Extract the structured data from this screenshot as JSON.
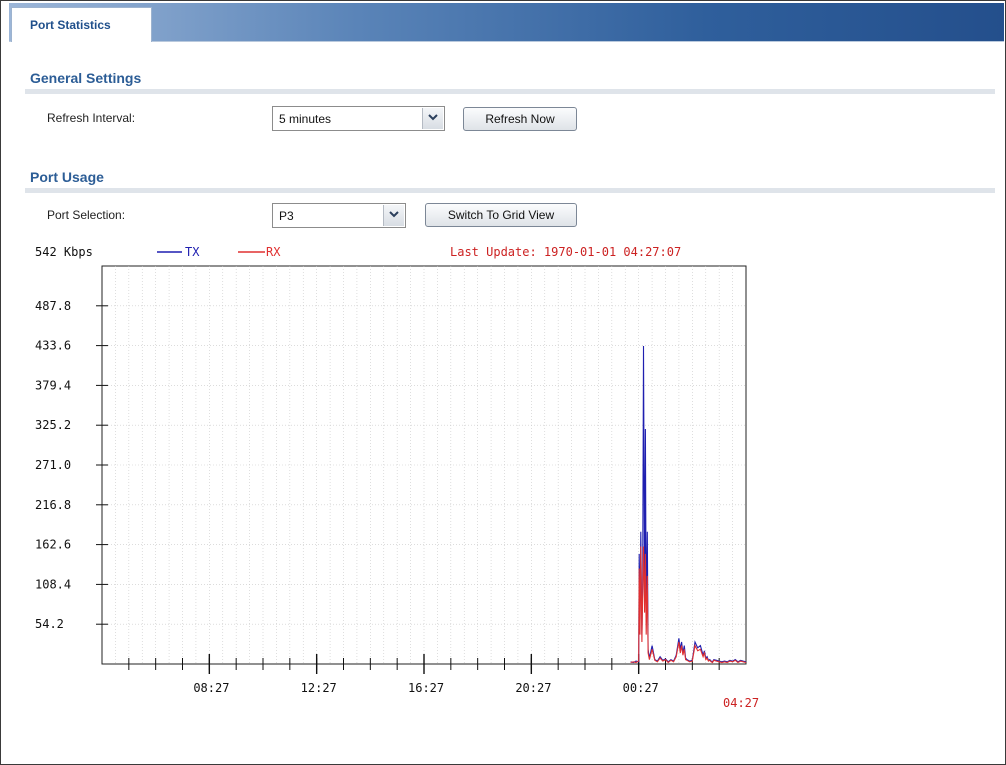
{
  "tab": {
    "label": "Port Statistics"
  },
  "general_settings": {
    "title": "General Settings",
    "refresh_interval_label": "Refresh Interval:",
    "refresh_interval_value": "5 minutes",
    "refresh_button": "Refresh Now"
  },
  "port_usage": {
    "title": "Port Usage",
    "port_selection_label": "Port Selection:",
    "port_selection_value": "P3",
    "switch_button": "Switch To Grid View"
  },
  "chart_header": {
    "max_label": "542 Kbps",
    "tx_label": "TX",
    "rx_label": "RX",
    "last_update": "Last Update: 1970-01-01 04:27:07",
    "current_time_label": "04:27"
  },
  "colors": {
    "tx": "#1f1fb0",
    "rx": "#e03030",
    "accent": "#2c5d96",
    "update_text": "#cc2222"
  },
  "chart_data": {
    "type": "line",
    "x_unit": "hours before last update",
    "xlim": [
      -24,
      0
    ],
    "ylim": [
      0,
      542
    ],
    "y_ticks": [
      "487.8",
      "433.6",
      "379.4",
      "325.2",
      "271.0",
      "216.8",
      "162.6",
      "108.4",
      "54.2"
    ],
    "x_ticks": [
      "08:27",
      "12:27",
      "16:27",
      "20:27",
      "00:27"
    ],
    "grid": true,
    "legend": "top",
    "series": [
      {
        "name": "TX",
        "color": "#1f1fb0",
        "x": [
          -4.3,
          -4.2,
          -4.1,
          -4.0,
          -3.98,
          -3.95,
          -3.92,
          -3.88,
          -3.85,
          -3.82,
          -3.78,
          -3.75,
          -3.72,
          -3.68,
          -3.65,
          -3.6,
          -3.5,
          -3.4,
          -3.3,
          -3.2,
          -3.1,
          -3.0,
          -2.9,
          -2.8,
          -2.7,
          -2.6,
          -2.5,
          -2.45,
          -2.4,
          -2.35,
          -2.3,
          -2.25,
          -2.2,
          -2.1,
          -2.0,
          -1.9,
          -1.8,
          -1.7,
          -1.6,
          -1.55,
          -1.5,
          -1.45,
          -1.4,
          -1.35,
          -1.3,
          -1.25,
          -1.2,
          -1.1,
          -1.0,
          -0.9,
          -0.8,
          -0.7,
          -0.6,
          -0.5,
          -0.4,
          -0.3,
          -0.2,
          -0.1,
          0
        ],
        "y": [
          3,
          2,
          4,
          3,
          150,
          60,
          180,
          40,
          110,
          433,
          90,
          320,
          60,
          180,
          20,
          8,
          25,
          6,
          4,
          10,
          5,
          7,
          3,
          6,
          4,
          12,
          35,
          20,
          30,
          15,
          25,
          8,
          6,
          4,
          5,
          30,
          22,
          25,
          12,
          18,
          8,
          10,
          5,
          6,
          4,
          3,
          6,
          5,
          4,
          3,
          4,
          3,
          5,
          4,
          6,
          3,
          5,
          4,
          3
        ]
      },
      {
        "name": "RX",
        "color": "#e03030",
        "x": [
          -4.3,
          -4.2,
          -4.1,
          -4.0,
          -3.98,
          -3.95,
          -3.92,
          -3.88,
          -3.85,
          -3.82,
          -3.78,
          -3.75,
          -3.72,
          -3.68,
          -3.65,
          -3.6,
          -3.5,
          -3.4,
          -3.3,
          -3.2,
          -3.1,
          -3.0,
          -2.9,
          -2.8,
          -2.7,
          -2.6,
          -2.5,
          -2.45,
          -2.4,
          -2.35,
          -2.3,
          -2.25,
          -2.2,
          -2.1,
          -2.0,
          -1.9,
          -1.8,
          -1.7,
          -1.6,
          -1.55,
          -1.5,
          -1.45,
          -1.4,
          -1.35,
          -1.3,
          -1.25,
          -1.2,
          -1.1,
          -1.0,
          -0.9,
          -0.8,
          -0.7,
          -0.6,
          -0.5,
          -0.4,
          -0.3,
          -0.2,
          -0.1,
          0
        ],
        "y": [
          2,
          3,
          2,
          4,
          130,
          40,
          160,
          30,
          100,
          160,
          70,
          150,
          40,
          120,
          15,
          6,
          20,
          5,
          3,
          8,
          4,
          6,
          2,
          5,
          3,
          10,
          30,
          15,
          25,
          12,
          20,
          6,
          5,
          3,
          4,
          25,
          18,
          20,
          10,
          15,
          6,
          8,
          4,
          5,
          3,
          2,
          5,
          4,
          3,
          2,
          3,
          2,
          4,
          3,
          5,
          2,
          4,
          3,
          2
        ]
      }
    ]
  }
}
